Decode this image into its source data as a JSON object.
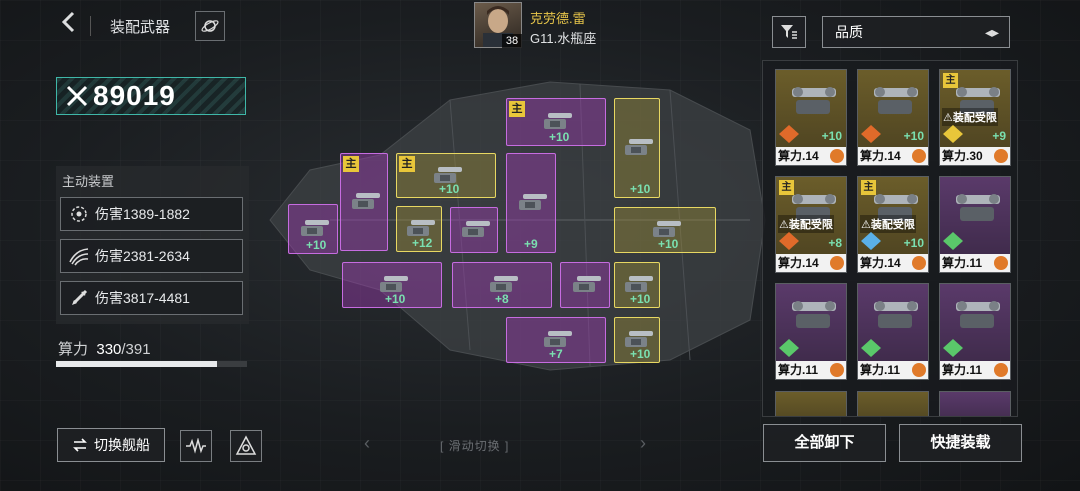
{
  "header": {
    "title": "装配武器"
  },
  "power": {
    "value": "89019"
  },
  "commander": {
    "name": "克劳德.雷",
    "ship": "G11.水瓶座",
    "level": "38"
  },
  "active_devices": {
    "title": "主动装置",
    "skills": [
      {
        "label": "伤害1389-1882",
        "icon": "target-icon"
      },
      {
        "label": "伤害2381-2634",
        "icon": "claw-icon"
      },
      {
        "label": "伤害3817-4481",
        "icon": "missile-icon"
      }
    ]
  },
  "capacity": {
    "label": "算力",
    "current": "330",
    "max": "/391",
    "fill": 0.844
  },
  "buttons": {
    "switch_ship": "切换舰船",
    "unequip_all": "全部卸下",
    "quick_equip": "快捷装载"
  },
  "slide_hint": "滑动切换",
  "filter": {
    "selected": "品质"
  },
  "main_tag": "主",
  "ship_slots": [
    {
      "id": "s1",
      "quality": "purple",
      "level": "+10",
      "main": false
    },
    {
      "id": "s2",
      "quality": "purple",
      "level": "",
      "main": true
    },
    {
      "id": "s3",
      "quality": "gold",
      "level": "+10",
      "main": true
    },
    {
      "id": "s4",
      "quality": "gold",
      "level": "+12",
      "main": false
    },
    {
      "id": "s5",
      "quality": "purple",
      "level": "",
      "main": false
    },
    {
      "id": "s6",
      "quality": "purple",
      "level": "+10",
      "main": true
    },
    {
      "id": "s7",
      "quality": "purple",
      "level": "+9",
      "main": false
    },
    {
      "id": "s8",
      "quality": "gold",
      "level": "+10",
      "main": false
    },
    {
      "id": "s9",
      "quality": "gold",
      "level": "+10",
      "main": false
    },
    {
      "id": "s10",
      "quality": "purple",
      "level": "+10",
      "main": false
    },
    {
      "id": "s11",
      "quality": "purple",
      "level": "+8",
      "main": false
    },
    {
      "id": "s12",
      "quality": "purple",
      "level": "",
      "main": false
    },
    {
      "id": "s13",
      "quality": "gold",
      "level": "+10",
      "main": false
    },
    {
      "id": "s14",
      "quality": "purple",
      "level": "+7",
      "main": false
    },
    {
      "id": "s15",
      "quality": "gold",
      "level": "+10",
      "main": false
    }
  ],
  "inventory": [
    {
      "quality": "gold",
      "main": false,
      "level": "+10",
      "restricted": "",
      "power": "算力.14",
      "element": "fire"
    },
    {
      "quality": "gold",
      "main": false,
      "level": "+10",
      "restricted": "",
      "power": "算力.14",
      "element": "fire"
    },
    {
      "quality": "gold",
      "main": true,
      "level": "+9",
      "restricted": "装配受限",
      "power": "算力.30",
      "element": "lightning"
    },
    {
      "quality": "gold",
      "main": true,
      "level": "+8",
      "restricted": "装配受限",
      "power": "算力.14",
      "element": "fire"
    },
    {
      "quality": "gold",
      "main": true,
      "level": "+10",
      "restricted": "装配受限",
      "power": "算力.14",
      "element": "ice"
    },
    {
      "quality": "purple",
      "main": false,
      "level": "",
      "restricted": "",
      "power": "算力.11",
      "element": "nature"
    },
    {
      "quality": "purple",
      "main": false,
      "level": "",
      "restricted": "",
      "power": "算力.11",
      "element": "nature"
    },
    {
      "quality": "purple",
      "main": false,
      "level": "",
      "restricted": "",
      "power": "算力.11",
      "element": "nature"
    },
    {
      "quality": "purple",
      "main": false,
      "level": "",
      "restricted": "",
      "power": "算力.11",
      "element": "nature"
    }
  ],
  "colors": {
    "accent": "#3fb7a8",
    "gold": "#e8d862",
    "purple": "#c66ce0",
    "level": "#7ae0b0"
  }
}
